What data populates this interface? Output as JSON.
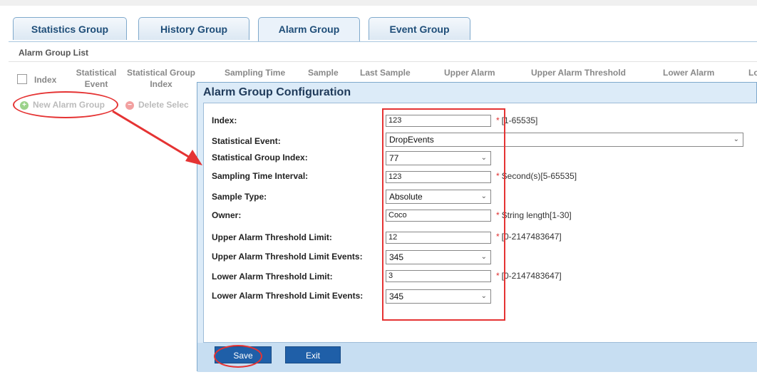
{
  "tabs": [
    {
      "label": "Statistics Group"
    },
    {
      "label": "History Group"
    },
    {
      "label": "Alarm Group"
    },
    {
      "label": "Event Group"
    }
  ],
  "list": {
    "title": "Alarm Group List",
    "columns": [
      "Index",
      "Statistical Event",
      "Statistical Group Index",
      "Sampling Time",
      "Sample",
      "Last Sample",
      "Upper Alarm",
      "Upper Alarm Threshold",
      "Lower Alarm",
      "Lo"
    ]
  },
  "toolbar": {
    "new_label": "New Alarm Group",
    "delete_label": "Delete Selec"
  },
  "dialog": {
    "title": "Alarm Group Configuration",
    "fields": [
      {
        "label": "Index:",
        "value": "123",
        "hint": "[1-65535]",
        "required": "*"
      },
      {
        "label": "Statistical Event:",
        "value": "DropEvents"
      },
      {
        "label": "Statistical Group Index:",
        "value": "77"
      },
      {
        "label": "Sampling Time Interval:",
        "value": "123",
        "hint": "Second(s)[5-65535]",
        "required": "*"
      },
      {
        "label": "Sample Type:",
        "value": "Absolute"
      },
      {
        "label": "Owner:",
        "value": "Coco",
        "hint": "String length[1-30]",
        "required": "*"
      },
      {
        "label": "Upper Alarm Threshold Limit:",
        "value": "12",
        "hint": "[0-2147483647]",
        "required": "*"
      },
      {
        "label": "Upper Alarm Threshold Limit Events:",
        "value": "345"
      },
      {
        "label": "Lower Alarm Threshold Limit:",
        "value": "3",
        "hint": "[0-2147483647]",
        "required": "*"
      },
      {
        "label": "Lower Alarm Threshold Limit Events:",
        "value": "345"
      }
    ],
    "save_label": "Save",
    "exit_label": "Exit"
  },
  "icons": {
    "chevron": "chevron-down-icon",
    "add": "plus-circle-icon",
    "delete": "minus-circle-icon"
  },
  "colors": {
    "accent": "#1f5fa8",
    "annotation": "#e53333",
    "required": "#e03030"
  }
}
